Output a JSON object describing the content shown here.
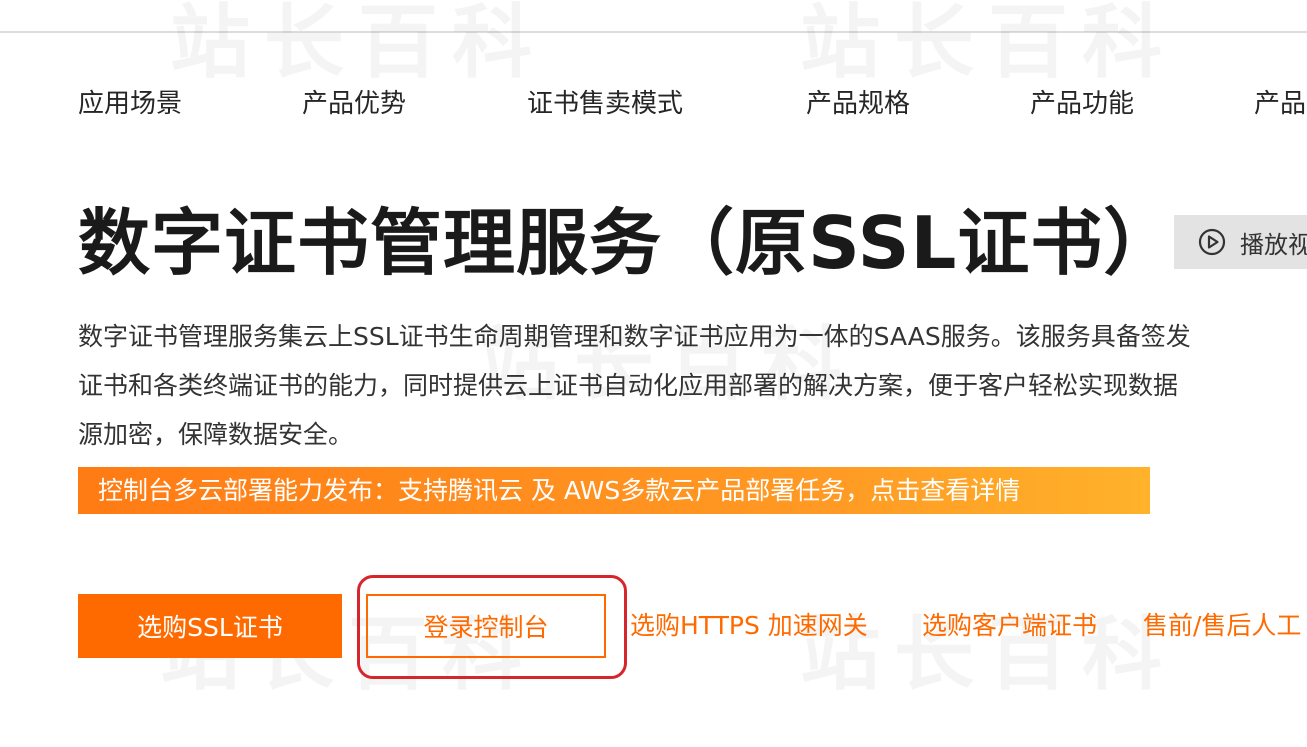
{
  "nav": {
    "items": [
      {
        "label": "应用场景"
      },
      {
        "label": "产品优势"
      },
      {
        "label": "证书售卖模式"
      },
      {
        "label": "产品规格"
      },
      {
        "label": "产品功能"
      },
      {
        "label": "产品"
      }
    ]
  },
  "hero": {
    "title": "数字证书管理服务（原SSL证书）",
    "play_label": "播放视",
    "description_lines": [
      "数字证书管理服务集云上SSL证书生命周期管理和数字证书应用为一体的SAAS服务。该服务具备签发",
      "证书和各类终端证书的能力，同时提供云上证书自动化应用部署的解决方案，便于客户轻松实现数据",
      "源加密，保障数据安全。"
    ]
  },
  "banner": {
    "text": "控制台多云部署能力发布：支持腾讯云 及 AWS多款云产品部署任务，点击查看详情"
  },
  "actions": {
    "buy_ssl": "选购SSL证书",
    "login_console": "登录控制台",
    "links": [
      {
        "label": "选购HTTPS 加速网关"
      },
      {
        "label": "选购客户端证书"
      },
      {
        "label": "售前/售后人工"
      }
    ]
  },
  "watermark": {
    "text": "站长百科"
  },
  "colors": {
    "accent": "#ff6a00",
    "banner_start": "#ff7b14",
    "banner_end": "#ffb22a",
    "highlight": "#d6262b"
  }
}
